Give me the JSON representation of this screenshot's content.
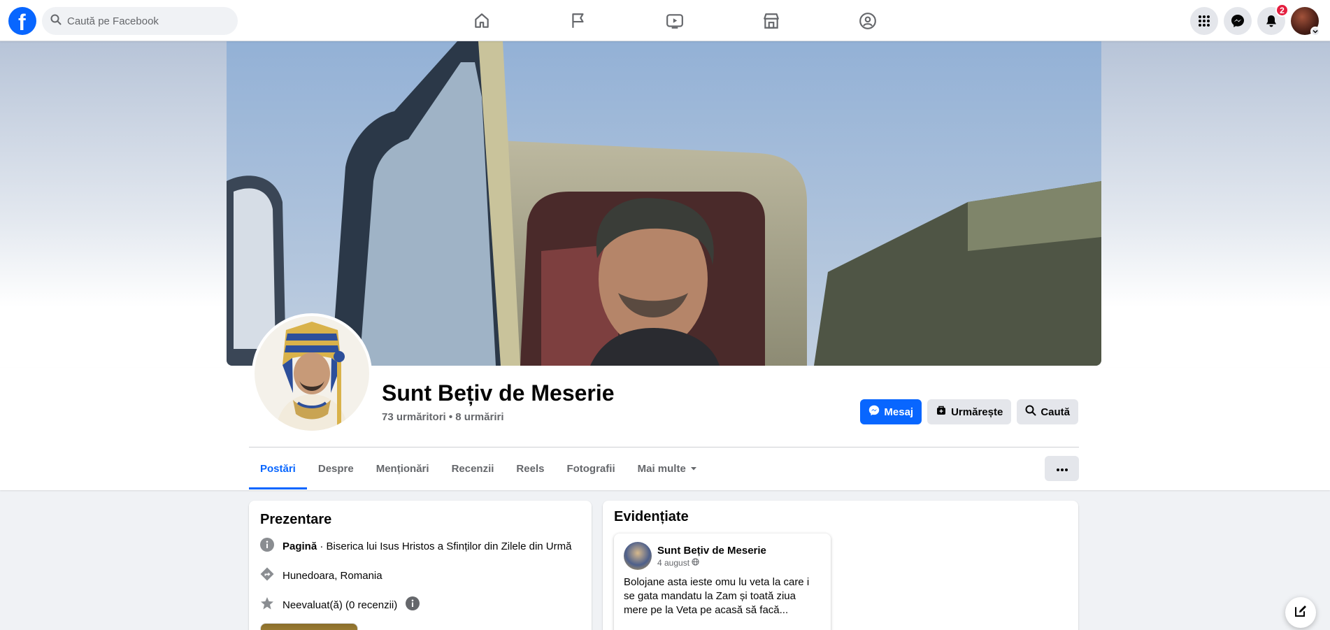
{
  "topbar": {
    "search_placeholder": "Caută pe Facebook",
    "notification_count": "2",
    "nav_icons": [
      "home-icon",
      "flag-icon",
      "video-icon",
      "marketplace-icon",
      "groups-icon"
    ]
  },
  "profile": {
    "name": "Sunt Bețiv de Meserie",
    "followers": "73 urmăritori • 8 urmăriri",
    "buttons": {
      "message": "Mesaj",
      "follow": "Urmărește",
      "search": "Caută"
    }
  },
  "tabs": [
    {
      "label": "Postări"
    },
    {
      "label": "Despre"
    },
    {
      "label": "Menționări"
    },
    {
      "label": "Recenzii"
    },
    {
      "label": "Reels"
    },
    {
      "label": "Fotografii"
    },
    {
      "label": "Mai multe"
    }
  ],
  "intro": {
    "title": "Prezentare",
    "page_type_bold": "Pagină",
    "page_type_rest": " · Biserica lui Isus Hristos a Sfinților din Zilele din Urmă",
    "location": "Hunedoara, Romania",
    "rating": "Neevaluat(ă) (0 recenzii)"
  },
  "featured": {
    "title": "Evidențiate",
    "post": {
      "author": "Sunt Bețiv de Meserie",
      "date": "4 august",
      "text": "Bolojane asta ieste omu lu veta la care i se gata mandatu la Zam și toată ziua mere pe la Veta pe acasă să facă..."
    }
  },
  "colors": {
    "brand": "#0866ff",
    "badge": "#e41e3f",
    "background": "#f0f2f5"
  }
}
